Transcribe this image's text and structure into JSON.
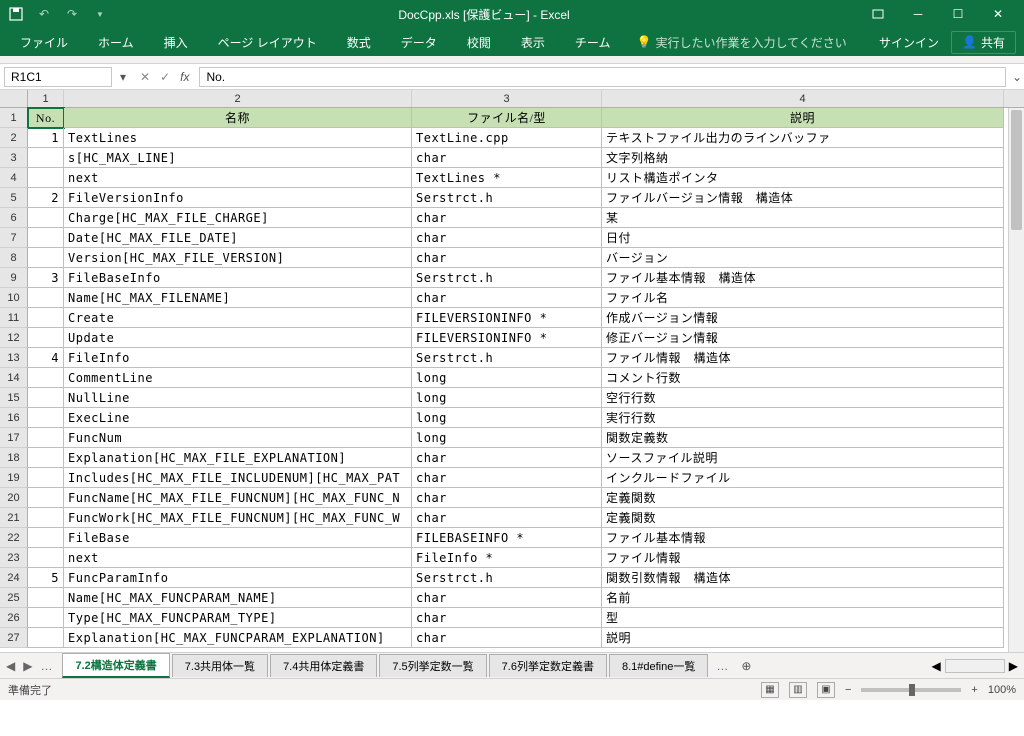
{
  "title": "DocCpp.xls  [保護ビュー] - Excel",
  "ribbon": {
    "tabs": [
      "ファイル",
      "ホーム",
      "挿入",
      "ページ レイアウト",
      "数式",
      "データ",
      "校閲",
      "表示",
      "チーム"
    ],
    "tellme": "実行したい作業を入力してください",
    "signin": "サインイン",
    "share": "共有"
  },
  "namebox": "R1C1",
  "formula": "No.",
  "col_headers": [
    "1",
    "2",
    "3",
    "4"
  ],
  "header_row": {
    "no": "No.",
    "name": "名称",
    "file": "ファイル名/型",
    "desc": "説明"
  },
  "rows": [
    {
      "no": "1",
      "name": "TextLines",
      "file": "TextLine.cpp",
      "desc": "テキストファイル出力のラインバッファ"
    },
    {
      "no": "",
      "name": "s[HC_MAX_LINE]",
      "file": "char",
      "desc": "文字列格納"
    },
    {
      "no": "",
      "name": "next",
      "file": "TextLines *",
      "desc": "リスト構造ポインタ"
    },
    {
      "no": "2",
      "name": "FileVersionInfo",
      "file": "Serstrct.h",
      "desc": "ファイルバージョン情報　構造体"
    },
    {
      "no": "",
      "name": "Charge[HC_MAX_FILE_CHARGE]",
      "file": "char",
      "desc": "某"
    },
    {
      "no": "",
      "name": "Date[HC_MAX_FILE_DATE]",
      "file": "char",
      "desc": "日付"
    },
    {
      "no": "",
      "name": "Version[HC_MAX_FILE_VERSION]",
      "file": "char",
      "desc": "バージョン"
    },
    {
      "no": "3",
      "name": "FileBaseInfo",
      "file": "Serstrct.h",
      "desc": "ファイル基本情報　構造体"
    },
    {
      "no": "",
      "name": "Name[HC_MAX_FILENAME]",
      "file": "char",
      "desc": "ファイル名"
    },
    {
      "no": "",
      "name": "Create",
      "file": "FILEVERSIONINFO *",
      "desc": "作成バージョン情報"
    },
    {
      "no": "",
      "name": "Update",
      "file": "FILEVERSIONINFO *",
      "desc": "修正バージョン情報"
    },
    {
      "no": "4",
      "name": "FileInfo",
      "file": "Serstrct.h",
      "desc": "ファイル情報　構造体"
    },
    {
      "no": "",
      "name": "CommentLine",
      "file": "long",
      "desc": "コメント行数"
    },
    {
      "no": "",
      "name": "NullLine",
      "file": "long",
      "desc": "空行行数"
    },
    {
      "no": "",
      "name": "ExecLine",
      "file": "long",
      "desc": "実行行数"
    },
    {
      "no": "",
      "name": "FuncNum",
      "file": "long",
      "desc": "関数定義数"
    },
    {
      "no": "",
      "name": "Explanation[HC_MAX_FILE_EXPLANATION]",
      "file": "char",
      "desc": "ソースファイル説明"
    },
    {
      "no": "",
      "name": "Includes[HC_MAX_FILE_INCLUDENUM][HC_MAX_PAT",
      "file": "char",
      "desc": "インクルードファイル"
    },
    {
      "no": "",
      "name": "FuncName[HC_MAX_FILE_FUNCNUM][HC_MAX_FUNC_N",
      "file": "char",
      "desc": "定義関数"
    },
    {
      "no": "",
      "name": "FuncWork[HC_MAX_FILE_FUNCNUM][HC_MAX_FUNC_W",
      "file": "char",
      "desc": "定義関数"
    },
    {
      "no": "",
      "name": "FileBase",
      "file": "FILEBASEINFO *",
      "desc": "ファイル基本情報"
    },
    {
      "no": "",
      "name": "next",
      "file": "FileInfo *",
      "desc": "ファイル情報"
    },
    {
      "no": "5",
      "name": "FuncParamInfo",
      "file": "Serstrct.h",
      "desc": "関数引数情報　構造体"
    },
    {
      "no": "",
      "name": "Name[HC_MAX_FUNCPARAM_NAME]",
      "file": "char",
      "desc": "名前"
    },
    {
      "no": "",
      "name": "Type[HC_MAX_FUNCPARAM_TYPE]",
      "file": "char",
      "desc": "型"
    },
    {
      "no": "",
      "name": "Explanation[HC_MAX_FUNCPARAM_EXPLANATION]",
      "file": "char",
      "desc": "説明"
    }
  ],
  "sheets": [
    "7.2構造体定義書",
    "7.3共用体一覧",
    "7.4共用体定義書",
    "7.5列挙定数一覧",
    "7.6列挙定数定義書",
    "8.1#define一覧"
  ],
  "status": "準備完了",
  "zoom": "100%"
}
